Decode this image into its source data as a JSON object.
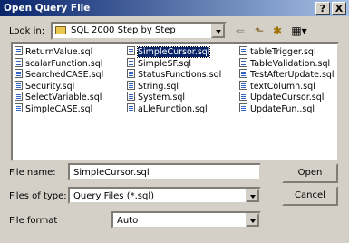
{
  "window": {
    "title": "Open Query File",
    "help_label": "?",
    "close_label": "X"
  },
  "lookin": {
    "label": "Look in:",
    "folder": "SQL 2000 Step by Step"
  },
  "toolbar": {
    "icons": [
      "back-icon",
      "up-folder-icon",
      "new-folder-icon",
      "views-menu-icon"
    ],
    "back_glyph": "⇐",
    "up_glyph": "⬑",
    "new_glyph": "✱",
    "views_glyph": "▦▾"
  },
  "files": {
    "columns": [
      [
        "ReturnValue.sql",
        "scalarFunction.sql",
        "SearchedCASE.sql",
        "Security.sql",
        "SelectVariable.sql",
        "SimpleCASE.sql"
      ],
      [
        "SimpleCursor.sql",
        "SimpleSF.sql",
        "StatusFunctions.sql",
        "String.sql",
        "System.sql",
        "aLleFunction.sql"
      ],
      [
        "tableTrigger.sql",
        "TableValidation.sql",
        "TestAfterUpdate.sql",
        "textColumn.sql",
        "UpdateCursor.sql",
        "UpdateFun..sql"
      ]
    ],
    "selected": "SimpleCursor.sql"
  },
  "form": {
    "filename_label": "File name:",
    "filename_value": "SimpleCursor.sql",
    "filetype_label": "Files of type:",
    "filetype_value": "Query Files (*.sql)",
    "format_label": "File format",
    "format_value": "Auto"
  },
  "buttons": {
    "open": "Open",
    "cancel": "Cancel"
  },
  "colors": {
    "titlebar_start": "#08246b",
    "titlebar_end": "#a5c0e5",
    "selection": "#0a246a",
    "face": "#d4d0c8"
  }
}
